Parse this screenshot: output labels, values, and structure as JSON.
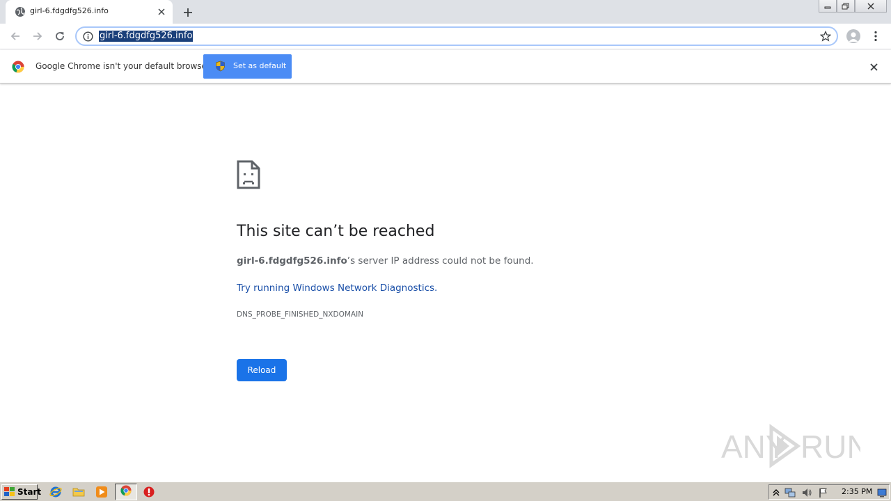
{
  "browser": {
    "tab_title": "girl-6.fdgdfg526.info",
    "url": "girl-6.fdgdfg526.info"
  },
  "infobar": {
    "message": "Google Chrome isn't your default browser",
    "set_default_label": "Set as default"
  },
  "error_page": {
    "title": "This site can’t be reached",
    "host": "girl-6.fdgdfg526.info",
    "description_suffix": "’s server IP address could not be found.",
    "diagnostics_link": "Try running Windows Network Diagnostics.",
    "error_code": "DNS_PROBE_FINISHED_NXDOMAIN",
    "reload_label": "Reload"
  },
  "watermark": {
    "text_left": "ANY",
    "text_right": "RUN"
  },
  "taskbar": {
    "start_label": "Start",
    "clock": "2:35 PM"
  },
  "colors": {
    "accent": "#1a73e8",
    "infobar_button": "#4b8cf5",
    "link": "#1a4fa8",
    "url_highlight": "#1a3f7a",
    "tabstrip": "#dee1e6",
    "taskbar": "#d4d0c8"
  },
  "icons": {
    "tab_favicon": "globe-icon",
    "tab_close": "close-icon",
    "new_tab": "plus-icon",
    "back": "arrow-left-icon",
    "forward": "arrow-right-icon",
    "reload": "reload-icon",
    "site_info": "info-icon",
    "bookmark": "star-icon",
    "profile": "avatar-icon",
    "menu": "kebab-menu-icon",
    "infobar_logo": "chrome-logo-icon",
    "infobar_shield": "uac-shield-icon",
    "infobar_close": "close-icon",
    "sad_page": "sad-page-icon"
  }
}
